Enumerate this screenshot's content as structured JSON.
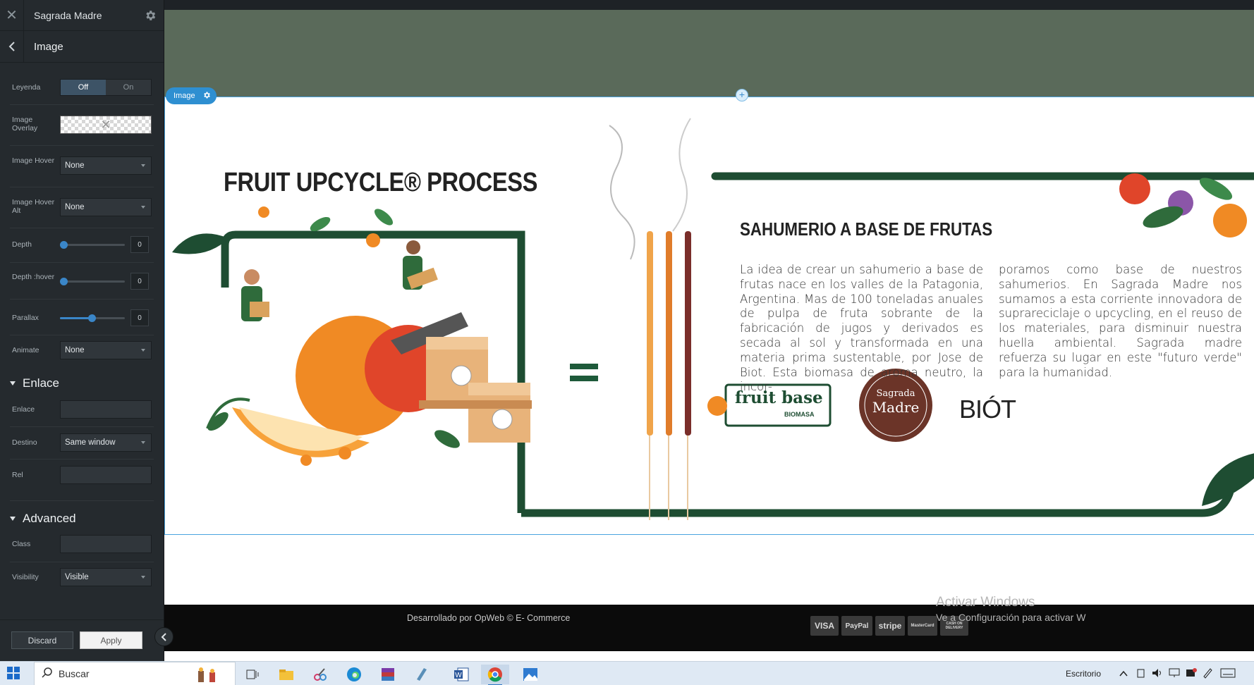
{
  "sidebar": {
    "site_name": "Sagrada Madre",
    "panel_title": "Image",
    "options": {
      "leyenda_label": "Leyenda",
      "toggle_off": "Off",
      "toggle_on": "On",
      "overlay_label": "Image Overlay",
      "hover_label": "Image Hover",
      "hover_value": "None",
      "hover_alt_label": "Image Hover Alt",
      "hover_alt_value": "None",
      "depth_label": "Depth",
      "depth_value": "0",
      "depth_hover_label": "Depth :hover",
      "depth_hover_value": "0",
      "parallax_label": "Parallax",
      "parallax_value": "0",
      "animate_label": "Animate",
      "animate_value": "None"
    },
    "enlace_section": {
      "title": "Enlace",
      "enlace_label": "Enlace",
      "destino_label": "Destino",
      "destino_value": "Same window",
      "rel_label": "Rel"
    },
    "advanced_section": {
      "title": "Advanced",
      "class_label": "Class",
      "visibility_label": "Visibility",
      "visibility_value": "Visible"
    },
    "footer": {
      "discard": "Discard",
      "apply": "Apply"
    }
  },
  "canvas": {
    "element_tag": "Image",
    "infographic": {
      "title": "FRUIT UPCYCLE® PROCESS",
      "subtitle": "SAHUMERIO A BASE DE FRUTAS",
      "para_left": "La idea de crear un sahumerio a base de frutas nace en los valles de la Patagonia, Argentina. Mas de 100 toneladas anuales de pulpa de fruta sobrante de la fabricación de jugos y derivados es secada al sol y transformada en una materia prima sustentable, por Jose de Biot. Esta biomasa de aroma neutro, la incor-",
      "para_right": "poramos como base de nuestros sahumerios. En Sagrada Madre nos sumamos a esta corriente innovadora de suprareciclaje o upcycling, en el reuso de los materiales, para disminuir nuestra huella ambiental. Sagrada madre refuerza su lugar en este \"futuro verde\" para la humanidad.",
      "logo_fruitbase": "fruit base",
      "logo_fruitbase_sub": "BIOMASA",
      "logo_sagrada_1": "Sagrada",
      "logo_sagrada_2": "Madre",
      "logo_biot": "BIÓT"
    },
    "footer_text": "Desarrollado por OpWeb © E- Commerce",
    "payments": [
      "VISA",
      "PayPal",
      "stripe",
      "MasterCard",
      "CASH ON DELIVERY"
    ],
    "watermark_title": "Activar Windows",
    "watermark_sub": "Ve a Configuración para activar W"
  },
  "taskbar": {
    "search_placeholder": "Buscar",
    "right_label": "Escritorio"
  },
  "colors": {
    "accent_blue": "#2e8fd1",
    "brand_green": "#1e4d32",
    "header_green": "#5a6a5a",
    "orange": "#f08a24"
  }
}
